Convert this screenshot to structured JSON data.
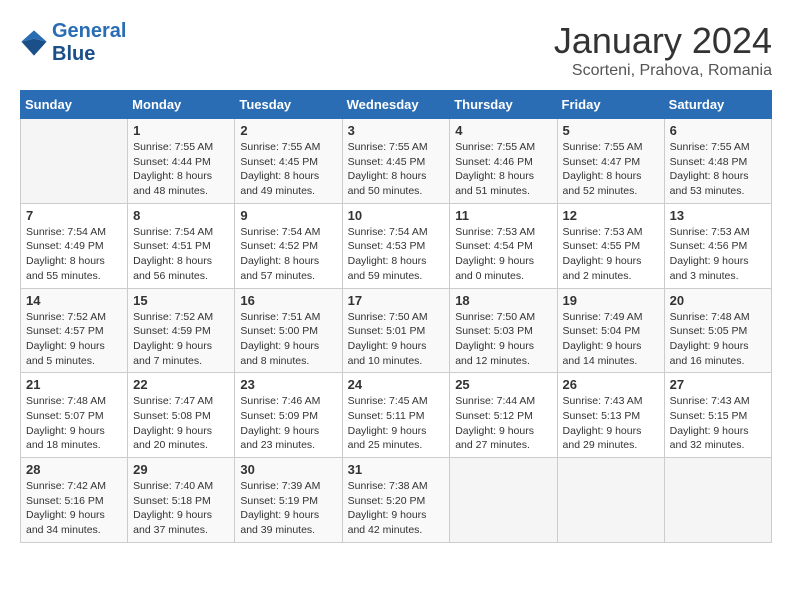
{
  "header": {
    "logo_line1": "General",
    "logo_line2": "Blue",
    "month": "January 2024",
    "location": "Scorteni, Prahova, Romania"
  },
  "days_of_week": [
    "Sunday",
    "Monday",
    "Tuesday",
    "Wednesday",
    "Thursday",
    "Friday",
    "Saturday"
  ],
  "weeks": [
    [
      {
        "day": "",
        "info": ""
      },
      {
        "day": "1",
        "info": "Sunrise: 7:55 AM\nSunset: 4:44 PM\nDaylight: 8 hours\nand 48 minutes."
      },
      {
        "day": "2",
        "info": "Sunrise: 7:55 AM\nSunset: 4:45 PM\nDaylight: 8 hours\nand 49 minutes."
      },
      {
        "day": "3",
        "info": "Sunrise: 7:55 AM\nSunset: 4:45 PM\nDaylight: 8 hours\nand 50 minutes."
      },
      {
        "day": "4",
        "info": "Sunrise: 7:55 AM\nSunset: 4:46 PM\nDaylight: 8 hours\nand 51 minutes."
      },
      {
        "day": "5",
        "info": "Sunrise: 7:55 AM\nSunset: 4:47 PM\nDaylight: 8 hours\nand 52 minutes."
      },
      {
        "day": "6",
        "info": "Sunrise: 7:55 AM\nSunset: 4:48 PM\nDaylight: 8 hours\nand 53 minutes."
      }
    ],
    [
      {
        "day": "7",
        "info": "Sunrise: 7:54 AM\nSunset: 4:49 PM\nDaylight: 8 hours\nand 55 minutes."
      },
      {
        "day": "8",
        "info": "Sunrise: 7:54 AM\nSunset: 4:51 PM\nDaylight: 8 hours\nand 56 minutes."
      },
      {
        "day": "9",
        "info": "Sunrise: 7:54 AM\nSunset: 4:52 PM\nDaylight: 8 hours\nand 57 minutes."
      },
      {
        "day": "10",
        "info": "Sunrise: 7:54 AM\nSunset: 4:53 PM\nDaylight: 8 hours\nand 59 minutes."
      },
      {
        "day": "11",
        "info": "Sunrise: 7:53 AM\nSunset: 4:54 PM\nDaylight: 9 hours\nand 0 minutes."
      },
      {
        "day": "12",
        "info": "Sunrise: 7:53 AM\nSunset: 4:55 PM\nDaylight: 9 hours\nand 2 minutes."
      },
      {
        "day": "13",
        "info": "Sunrise: 7:53 AM\nSunset: 4:56 PM\nDaylight: 9 hours\nand 3 minutes."
      }
    ],
    [
      {
        "day": "14",
        "info": "Sunrise: 7:52 AM\nSunset: 4:57 PM\nDaylight: 9 hours\nand 5 minutes."
      },
      {
        "day": "15",
        "info": "Sunrise: 7:52 AM\nSunset: 4:59 PM\nDaylight: 9 hours\nand 7 minutes."
      },
      {
        "day": "16",
        "info": "Sunrise: 7:51 AM\nSunset: 5:00 PM\nDaylight: 9 hours\nand 8 minutes."
      },
      {
        "day": "17",
        "info": "Sunrise: 7:50 AM\nSunset: 5:01 PM\nDaylight: 9 hours\nand 10 minutes."
      },
      {
        "day": "18",
        "info": "Sunrise: 7:50 AM\nSunset: 5:03 PM\nDaylight: 9 hours\nand 12 minutes."
      },
      {
        "day": "19",
        "info": "Sunrise: 7:49 AM\nSunset: 5:04 PM\nDaylight: 9 hours\nand 14 minutes."
      },
      {
        "day": "20",
        "info": "Sunrise: 7:48 AM\nSunset: 5:05 PM\nDaylight: 9 hours\nand 16 minutes."
      }
    ],
    [
      {
        "day": "21",
        "info": "Sunrise: 7:48 AM\nSunset: 5:07 PM\nDaylight: 9 hours\nand 18 minutes."
      },
      {
        "day": "22",
        "info": "Sunrise: 7:47 AM\nSunset: 5:08 PM\nDaylight: 9 hours\nand 20 minutes."
      },
      {
        "day": "23",
        "info": "Sunrise: 7:46 AM\nSunset: 5:09 PM\nDaylight: 9 hours\nand 23 minutes."
      },
      {
        "day": "24",
        "info": "Sunrise: 7:45 AM\nSunset: 5:11 PM\nDaylight: 9 hours\nand 25 minutes."
      },
      {
        "day": "25",
        "info": "Sunrise: 7:44 AM\nSunset: 5:12 PM\nDaylight: 9 hours\nand 27 minutes."
      },
      {
        "day": "26",
        "info": "Sunrise: 7:43 AM\nSunset: 5:13 PM\nDaylight: 9 hours\nand 29 minutes."
      },
      {
        "day": "27",
        "info": "Sunrise: 7:43 AM\nSunset: 5:15 PM\nDaylight: 9 hours\nand 32 minutes."
      }
    ],
    [
      {
        "day": "28",
        "info": "Sunrise: 7:42 AM\nSunset: 5:16 PM\nDaylight: 9 hours\nand 34 minutes."
      },
      {
        "day": "29",
        "info": "Sunrise: 7:40 AM\nSunset: 5:18 PM\nDaylight: 9 hours\nand 37 minutes."
      },
      {
        "day": "30",
        "info": "Sunrise: 7:39 AM\nSunset: 5:19 PM\nDaylight: 9 hours\nand 39 minutes."
      },
      {
        "day": "31",
        "info": "Sunrise: 7:38 AM\nSunset: 5:20 PM\nDaylight: 9 hours\nand 42 minutes."
      },
      {
        "day": "",
        "info": ""
      },
      {
        "day": "",
        "info": ""
      },
      {
        "day": "",
        "info": ""
      }
    ]
  ]
}
